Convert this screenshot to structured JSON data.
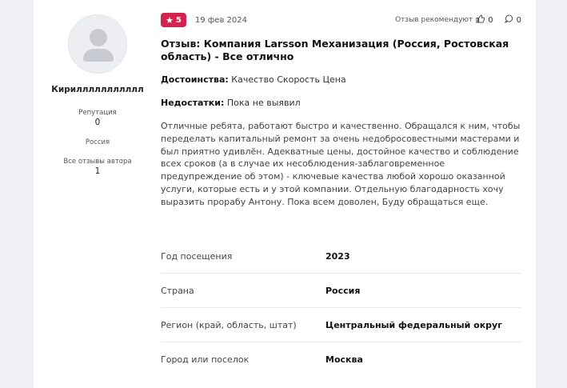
{
  "author": {
    "name": "Кириллллллллллл",
    "reputation_label": "Репутация",
    "reputation_value": "0",
    "country": "Россия",
    "all_reviews_label": "Все отзывы автора",
    "all_reviews_count": "1"
  },
  "review": {
    "rating": "5",
    "date": "19 фев 2024",
    "recommend_label": "Отзыв рекомендуют",
    "likes": "0",
    "comments": "0",
    "title": "Отзыв: Компания Larsson Механизация (Россия, Ростовская область) - Все отлично",
    "pros_label": "Достоинства:",
    "pros_value": "Качество Скорость Цена",
    "cons_label": "Недостатки:",
    "cons_value": "Пока не выявил",
    "text": "Отличные ребята, работают быстро и качественно. Обращался к ним, чтобы переделать капитальный ремонт за очень недобросовестными мастерами и был приятно удивлён. Адекватные цены, достойное качество и соблюдение всех сроков (а в случае их несоблюдения-заблаговременное предупреждение об этом) - ключевые качества любой хорошо оказанной услуги, которые есть и у этой компании. Отдельную благодарность хочу выразить прорабу Антону. Пока всем доволен, Буду обращаться еще."
  },
  "details": [
    {
      "label": "Год посещения",
      "value": "2023"
    },
    {
      "label": "Страна",
      "value": "Россия"
    },
    {
      "label": "Регион (край, область, штат)",
      "value": "Центральный федеральный округ"
    },
    {
      "label": "Город или поселок",
      "value": "Москва"
    }
  ],
  "colors": {
    "rating_badge": "#d3234f",
    "background": "#eef0f3"
  },
  "icons": [
    "user-avatar-icon",
    "star-icon",
    "thumbs-up-icon",
    "comment-icon"
  ]
}
